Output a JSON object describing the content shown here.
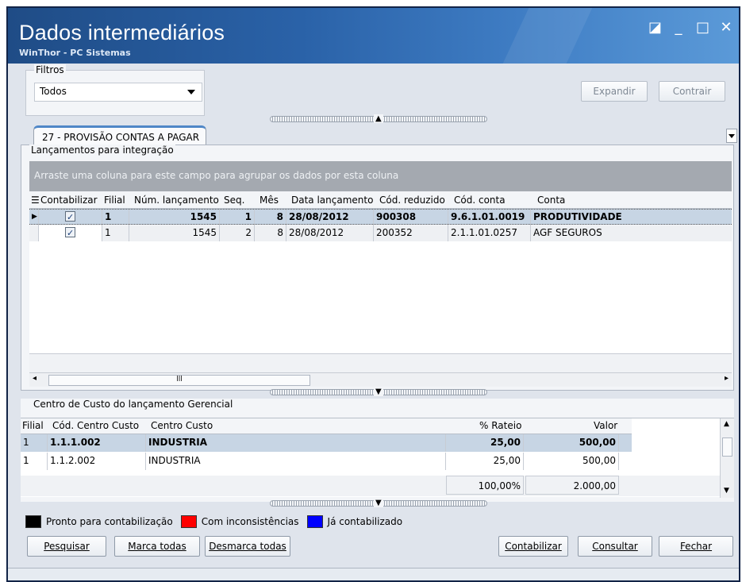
{
  "window": {
    "title": "Dados intermediários",
    "subtitle": "WinThor - PC Sistemas",
    "controls": [
      "◪",
      "_",
      "□",
      "✕"
    ]
  },
  "filters": {
    "label": "Filtros",
    "selected": "Todos"
  },
  "buttons": {
    "expand": "Expandir",
    "collapse": "Contrair",
    "search": "Pesquisar",
    "mark_all": "Marca todas",
    "unmark_all": "Desmarca todas",
    "post": "Contabilizar",
    "query": "Consultar",
    "close": "Fechar"
  },
  "tab": {
    "label": "27 - PROVISÃO CONTAS A PAGAR"
  },
  "postings": {
    "section_label": "Lançamentos para integração",
    "group_hint": "Arraste uma coluna para este campo para agrupar os dados por esta coluna",
    "columns": [
      "Contabilizar",
      "Filial",
      "Núm. lançamento",
      "Seq.",
      "Mês",
      "Data lançamento",
      "Cód. reduzido",
      "Cód. conta",
      "Conta"
    ],
    "rows": [
      {
        "filial": "1",
        "num": "1545",
        "seq": "1",
        "mes": "8",
        "data": "28/08/2012",
        "cod_reduzido": "900308",
        "cod_conta": "9.6.1.01.0019",
        "conta": "PRODUTIVIDADE",
        "checked": true
      },
      {
        "filial": "1",
        "num": "1545",
        "seq": "2",
        "mes": "8",
        "data": "28/08/2012",
        "cod_reduzido": "200352",
        "cod_conta": "2.1.1.01.0257",
        "conta": "AGF SEGUROS",
        "checked": true
      }
    ]
  },
  "cost_center": {
    "section_label": "Centro de Custo do lançamento Gerencial",
    "columns": [
      "Filial",
      "Cód. Centro Custo",
      "Centro Custo",
      "% Rateio",
      "Valor"
    ],
    "rows": [
      {
        "filial": "1",
        "codigo": "1.1.1.002",
        "centro": "INDUSTRIA",
        "rateio": "25,00",
        "valor": "500,00"
      },
      {
        "filial": "1",
        "codigo": "1.1.2.002",
        "centro": "INDUSTRIA",
        "rateio": "25,00",
        "valor": "500,00"
      }
    ],
    "totals": {
      "rateio": "100,00%",
      "valor": "2.000,00"
    }
  },
  "legend": [
    {
      "label": "Pronto para contabilização",
      "color": "#000000"
    },
    {
      "label": "Com inconsistências",
      "color": "#ff0000"
    },
    {
      "label": "Já contabilizado",
      "color": "#0000ff"
    }
  ]
}
